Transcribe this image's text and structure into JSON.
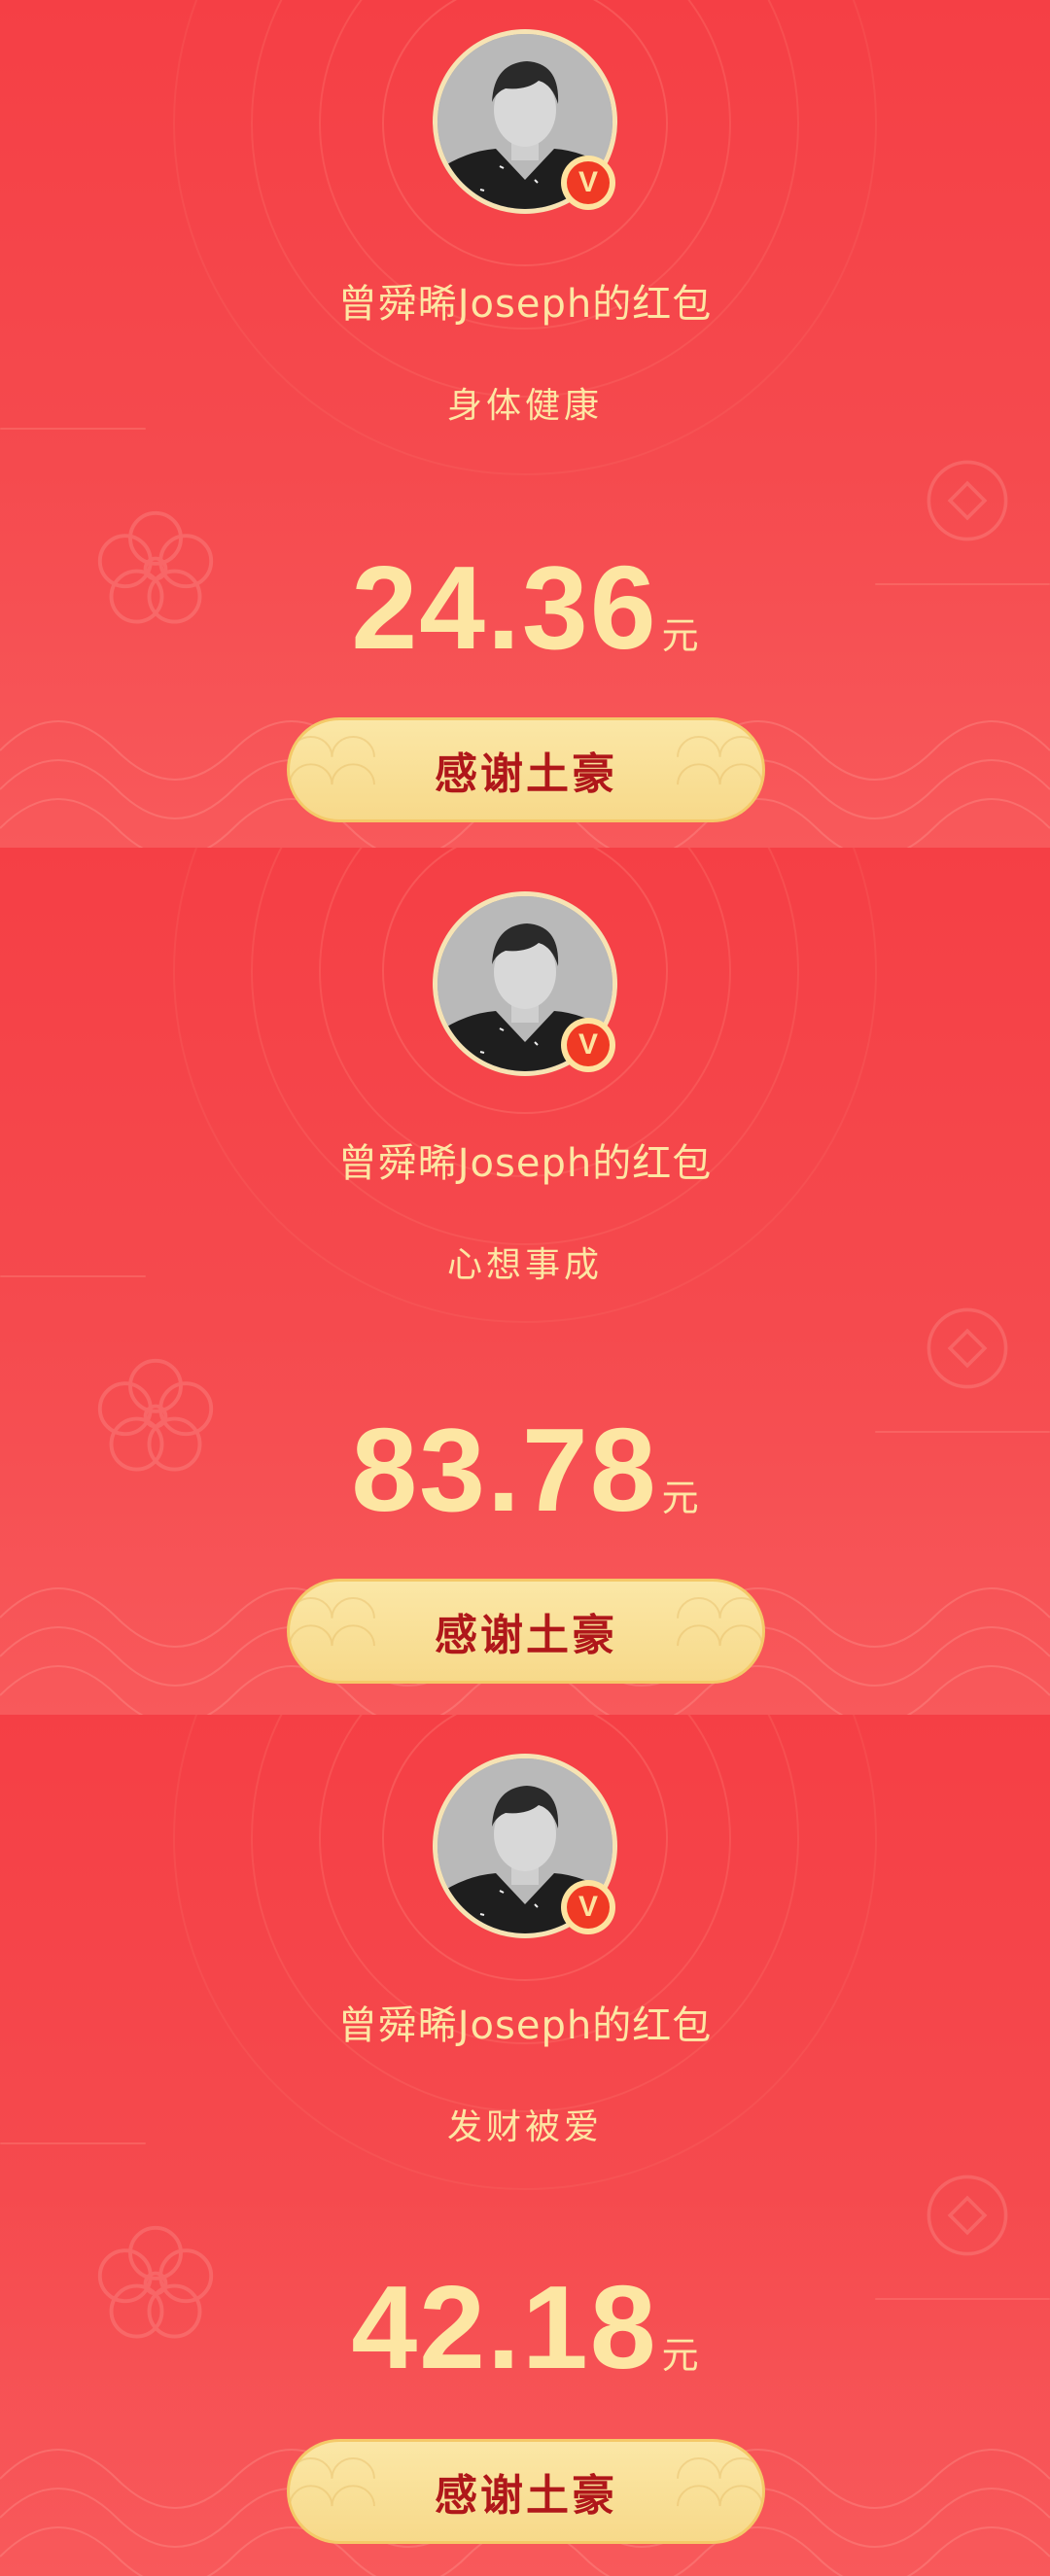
{
  "cards": [
    {
      "sender": "曾舜晞Joseph的红包",
      "blessing": "身体健康",
      "amount": "24.36",
      "unit": "元",
      "button_label": "感谢土豪",
      "verified_badge": "V"
    },
    {
      "sender": "曾舜晞Joseph的红包",
      "blessing": "心想事成",
      "amount": "83.78",
      "unit": "元",
      "button_label": "感谢土豪",
      "verified_badge": "V"
    },
    {
      "sender": "曾舜晞Joseph的红包",
      "blessing": "发财被爱",
      "amount": "42.18",
      "unit": "元",
      "button_label": "感谢土豪",
      "verified_badge": "V"
    }
  ],
  "colors": {
    "background": "#f4494c",
    "text_gold": "#fde6a3",
    "button_fill": "#f9e09a",
    "button_text": "#b0171a",
    "badge_red": "#f03a24"
  }
}
